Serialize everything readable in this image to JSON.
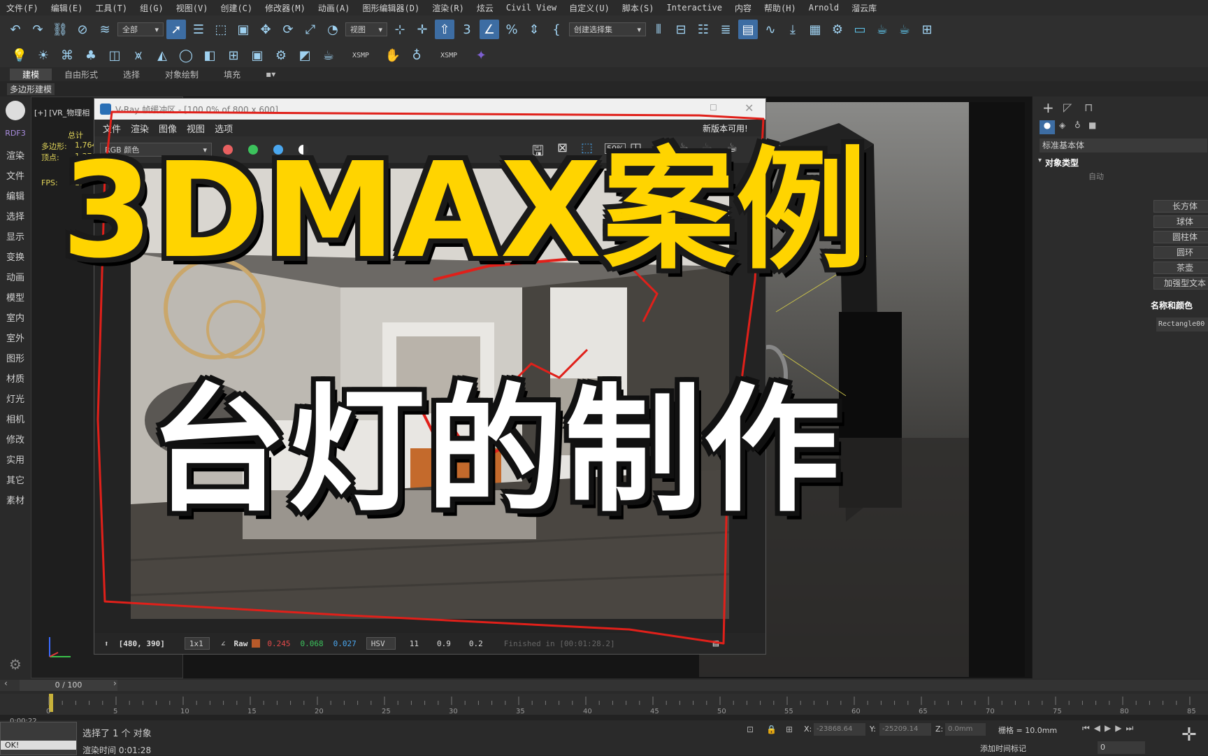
{
  "menu": [
    "文件(F)",
    "编辑(E)",
    "工具(T)",
    "组(G)",
    "视图(V)",
    "创建(C)",
    "修改器(M)",
    "动画(A)",
    "图形编辑器(D)",
    "渲染(R)",
    "炫云",
    "Civil View",
    "自定义(U)",
    "脚本(S)",
    "Interactive",
    "内容",
    "帮助(H)",
    "Arnold",
    "溜云库"
  ],
  "toolbar": {
    "selection_filter": "全部",
    "ref_coord": "视图",
    "named_selection": "创建选择集",
    "xsmp1": "XSMP",
    "xsmp2": "XSMP"
  },
  "ribbon": {
    "tabs": [
      "建模",
      "自由形式",
      "选择",
      "对象绘制",
      "填充"
    ],
    "sub": "多边形建模"
  },
  "left_panel": {
    "items": [
      "RDF3",
      "渲染",
      "文件",
      "编辑",
      "选择",
      "显示",
      "变换",
      "动画",
      "模型",
      "室内",
      "室外",
      "图形",
      "材质",
      "灯光",
      "相机",
      "修改",
      "实用",
      "其它",
      "素材"
    ]
  },
  "viewport": {
    "label": "[+] [VR_物理相",
    "stats_total": "总计",
    "stats_poly_label": "多边形:",
    "stats_poly_value": "1,764",
    "stats_vert_label": "顶点:",
    "stats_vert_value": "1,370",
    "fps_label": "FPS:",
    "fps_value": "25"
  },
  "vfb": {
    "title": "V-Ray 帧缓冲区 - [100.0% of 800 x 600]",
    "menu": [
      "文件",
      "渲染",
      "图像",
      "视图",
      "选项"
    ],
    "new_version": "新版本可用!",
    "channel": "RGB 颜色",
    "status": {
      "coords": "[480, 390]",
      "sample": "1x1",
      "raw": "Raw",
      "r": "0.245",
      "g": "0.068",
      "b": "0.027",
      "mode": "HSV",
      "h": "11",
      "s": "0.9",
      "v": "0.2",
      "finished": "Finished in [00:01:28.2]"
    }
  },
  "command_panel": {
    "category": "标准基本体",
    "object_type": "对象类型",
    "autogrid": "自动",
    "buttons": [
      "长方体",
      "球体",
      "圆柱体",
      "圆环",
      "茶壶",
      "加强型文本"
    ],
    "name_color": "名称和颜色",
    "name_value": "Rectangle00"
  },
  "timeline": {
    "frame": "0 / 100",
    "ticks": [
      "0",
      "5",
      "10",
      "15",
      "20",
      "25",
      "30",
      "35",
      "40",
      "45",
      "50",
      "55",
      "60",
      "65",
      "70",
      "75",
      "80",
      "85"
    ],
    "time": "0:00:22",
    "selected": "选择了 1 个 对象",
    "render_time": "渲染时间  0:01:28",
    "ok": "OK!",
    "x_label": "X:",
    "x_val": "-23868.64",
    "y_label": "Y:",
    "y_val": "-25209.14",
    "z_label": "Z:",
    "z_val": "0.0mm",
    "grid": "栅格 = 10.0mm",
    "add_key": "添加时间标记",
    "frame_field": "0"
  },
  "overlay": {
    "line1": "3DMAX案例",
    "line2": "台灯的制作"
  },
  "colors": {
    "yellow": "#ffd400",
    "red_annot": "#e0201a",
    "highlight": "#3d6da3"
  }
}
